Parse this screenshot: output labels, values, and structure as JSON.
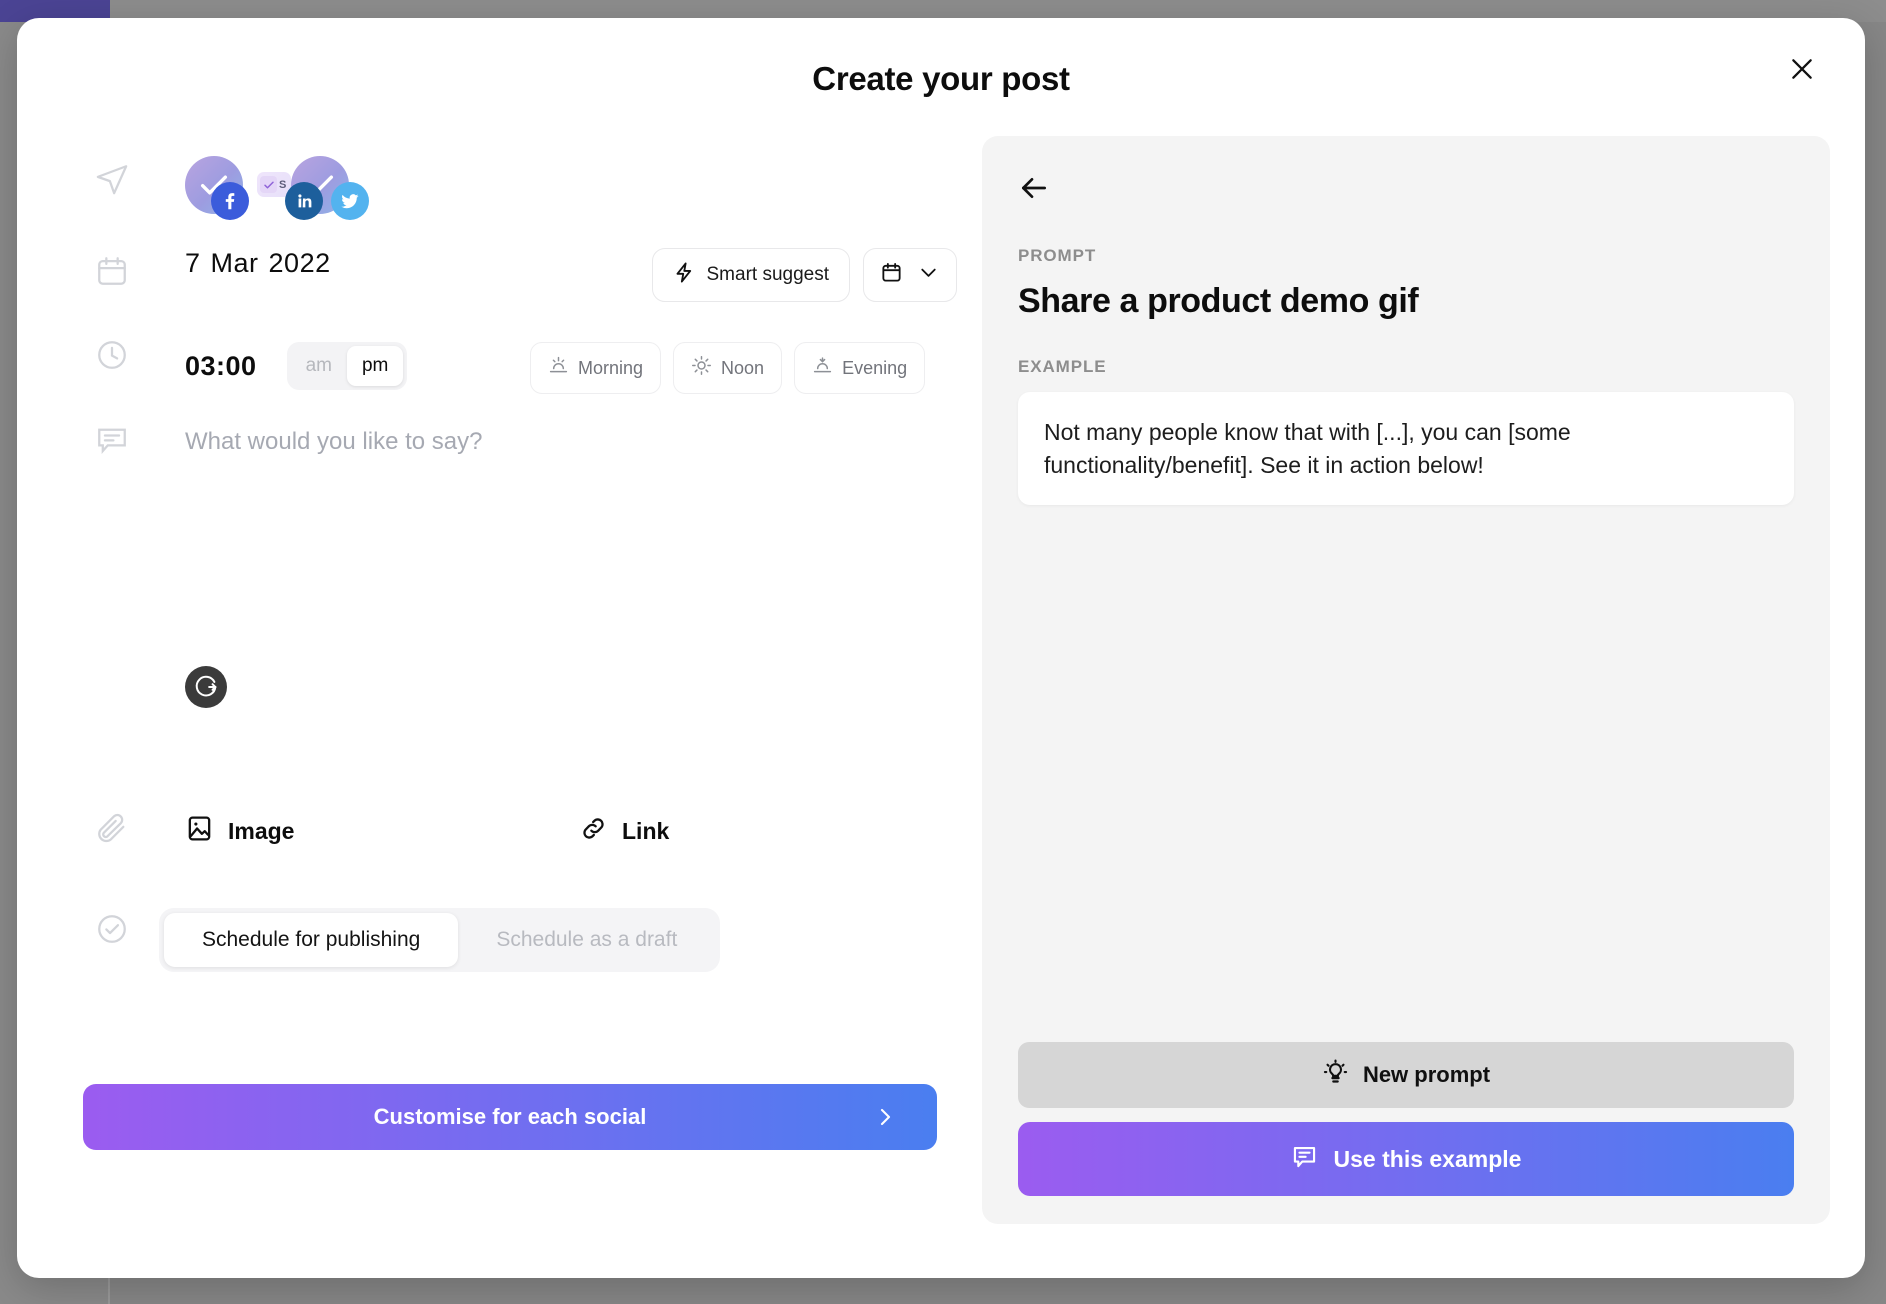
{
  "modal": {
    "title": "Create your post",
    "close_label": "Close"
  },
  "socials": {
    "accounts": [
      {
        "platform": "facebook",
        "icon": "facebook-icon"
      },
      {
        "platform": "linkedin",
        "icon": "linkedin-icon"
      },
      {
        "platform": "twitter",
        "icon": "twitter-icon"
      }
    ],
    "mini_chip_label": "S"
  },
  "schedule": {
    "date_day": "7",
    "date_month": "Mar",
    "date_year": "2022",
    "smart_suggest_label": "Smart suggest",
    "calendar_button_label": "",
    "time_value": "03:00",
    "am_label": "am",
    "pm_label": "pm",
    "meridiem_selected": "pm",
    "day_parts": [
      {
        "label": "Morning",
        "icon": "sunrise-icon"
      },
      {
        "label": "Noon",
        "icon": "sun-icon"
      },
      {
        "label": "Evening",
        "icon": "sunset-icon"
      }
    ]
  },
  "composer": {
    "placeholder": "What would you like to say?",
    "value": "",
    "grammarly_label": "Grammarly"
  },
  "attachments": [
    {
      "label": "Image",
      "icon": "image-icon"
    },
    {
      "label": "Link",
      "icon": "link-icon"
    }
  ],
  "publish": {
    "options": [
      "Schedule for publishing",
      "Schedule as a draft"
    ],
    "selected": "Schedule for publishing",
    "cta_label": "Customise for each social"
  },
  "prompt_panel": {
    "back_label": "Back",
    "prompt_caption": "PROMPT",
    "prompt_title": "Share a product demo gif",
    "example_caption": "EXAMPLE",
    "example_text": "Not many people know that with [...], you can [some functionality/benefit]. See it in action below!",
    "new_prompt_label": "New prompt",
    "use_example_label": "Use this example"
  },
  "colors": {
    "gradient_start": "#9b5cf0",
    "gradient_end": "#4a7ef0",
    "panel_bg": "#f4f4f4",
    "secondary_btn": "#d6d6d6"
  }
}
